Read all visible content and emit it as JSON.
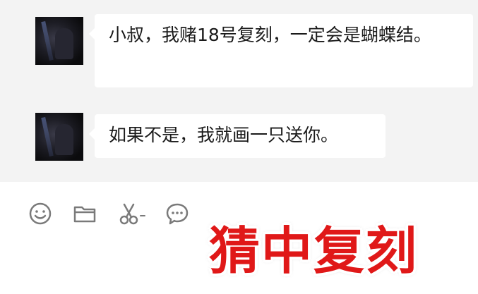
{
  "messages": [
    {
      "sender": "other",
      "text": "小叔，我赌18号复刻，一定会是蝴蝶结。"
    },
    {
      "sender": "other",
      "text": "如果不是，我就画一只送你。"
    }
  ],
  "toolbar": {
    "icons": [
      "emoji-icon",
      "folder-icon",
      "scissors-icon",
      "chat-bubble-icon"
    ]
  },
  "caption": {
    "text": "猜中复刻"
  },
  "colors": {
    "chat_background": "#f3f3f3",
    "bubble_background": "#ffffff",
    "caption_text": "#e01818",
    "caption_outline": "#ffffff",
    "icon_stroke": "#7a7a7a"
  }
}
